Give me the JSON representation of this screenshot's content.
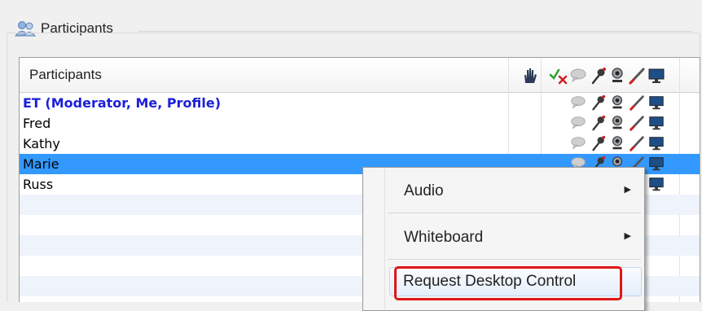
{
  "panel": {
    "title": "Participants",
    "icon": "people-icon"
  },
  "table": {
    "name_header": "Participants",
    "column_icons": [
      "raise-hand-icon",
      "yes-no-icon",
      "chat-icon",
      "microphone-icon",
      "webcam-icon",
      "whiteboard-pen-icon",
      "desktop-share-icon"
    ],
    "rows": [
      {
        "name": "ET (Moderator, Me, Profile)",
        "moderator": true
      },
      {
        "name": "Fred"
      },
      {
        "name": "Kathy"
      },
      {
        "name": "Marie",
        "selected": true
      },
      {
        "name": "Russ"
      }
    ]
  },
  "context_menu": {
    "items": [
      {
        "label": "Audio",
        "submenu_arrow": "▶"
      },
      {
        "label": "Whiteboard",
        "submenu_arrow": "▶"
      },
      {
        "label": "Request Desktop Control"
      }
    ]
  },
  "colors": {
    "selected_row": "#3399ff",
    "moderator_text": "#1c20d8",
    "highlight_border": "#e01616",
    "alt_row": "#eef3fc"
  }
}
